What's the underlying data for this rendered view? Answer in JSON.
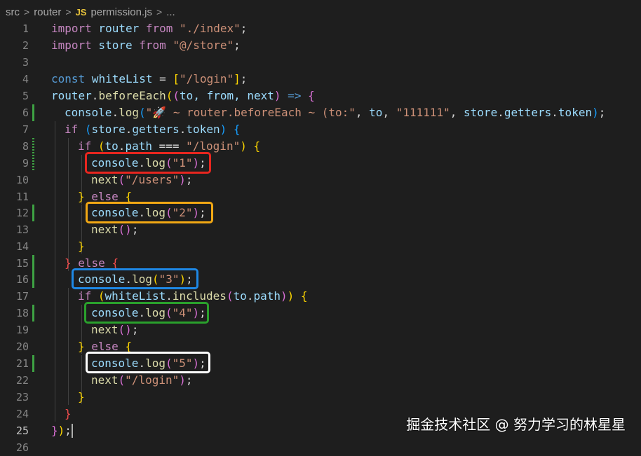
{
  "breadcrumb": {
    "seg1": "src",
    "seg2": "router",
    "file_icon": "JS",
    "file": "permission.js",
    "more": "..."
  },
  "lines": [
    {
      "n": "1"
    },
    {
      "n": "2"
    },
    {
      "n": "3"
    },
    {
      "n": "4"
    },
    {
      "n": "5"
    },
    {
      "n": "6"
    },
    {
      "n": "7"
    },
    {
      "n": "8"
    },
    {
      "n": "9"
    },
    {
      "n": "10"
    },
    {
      "n": "11"
    },
    {
      "n": "12"
    },
    {
      "n": "13"
    },
    {
      "n": "14"
    },
    {
      "n": "15"
    },
    {
      "n": "16"
    },
    {
      "n": "17"
    },
    {
      "n": "18"
    },
    {
      "n": "19"
    },
    {
      "n": "20"
    },
    {
      "n": "21"
    },
    {
      "n": "22"
    },
    {
      "n": "23"
    },
    {
      "n": "24"
    },
    {
      "n": "25"
    },
    {
      "n": "26"
    }
  ],
  "code": {
    "l1": {
      "kw": "import",
      "id": " router ",
      "from": "from",
      "str": " \"./index\"",
      "end": ";"
    },
    "l2": {
      "kw": "import",
      "id": " store ",
      "from": "from",
      "str": " \"@/store\"",
      "end": ";"
    },
    "l4": {
      "kw": "const",
      "id": " whiteList",
      "eq": " = ",
      "ob": "[",
      "str": "\"/login\"",
      "cb": "]",
      "end": ";"
    },
    "l5": {
      "obj": "router",
      "dot": ".",
      "fn": "beforeEach",
      "op1": "(",
      "op2": "(",
      "args": "to, from, next",
      "cp": ")",
      "arrow": " => ",
      "ob": "{"
    },
    "l6": {
      "obj": "console",
      "dot": ".",
      "fn": "log",
      "op": "(",
      "str": "\"🚀 ~ router.beforeEach ~ (to:\"",
      "c1": ", ",
      "v1": "to",
      "c2": ", ",
      "s2": "\"111111\"",
      "c3": ", ",
      "v2": "store",
      "d1": ".",
      "v3": "getters",
      "d2": ".",
      "v4": "token",
      "cp": ")",
      "end": ";"
    },
    "l7": {
      "kw": "if",
      "op": " (",
      "v1": "store",
      "d1": ".",
      "v2": "getters",
      "d2": ".",
      "v3": "token",
      "cp": ")",
      "ob": " {"
    },
    "l8": {
      "kw": "if",
      "op": " (",
      "v1": "to",
      "d1": ".",
      "v2": "path",
      "eq": " === ",
      "str": "\"/login\"",
      "cp": ")",
      "ob": " {"
    },
    "l9": {
      "obj": "console",
      "dot": ".",
      "fn": "log",
      "op": "(",
      "str": "\"1\"",
      "cp": ")",
      "end": ";"
    },
    "l10": {
      "fn": "next",
      "op": "(",
      "str": "\"/users\"",
      "cp": ")",
      "end": ";"
    },
    "l11": {
      "cb": "}",
      "kw": " else ",
      "ob": "{"
    },
    "l12": {
      "obj": "console",
      "dot": ".",
      "fn": "log",
      "op": "(",
      "str": "\"2\"",
      "cp": ")",
      "end": ";"
    },
    "l13": {
      "fn": "next",
      "op": "(",
      "cp": ")",
      "end": ";"
    },
    "l14": {
      "cb": "}"
    },
    "l15": {
      "cb": "}",
      "kw": " else ",
      "ob": "{"
    },
    "l16": {
      "obj": "console",
      "dot": ".",
      "fn": "log",
      "op": "(",
      "str": "\"3\"",
      "cp": ")",
      "end": ";"
    },
    "l17": {
      "kw": "if",
      "op": " (",
      "v1": "whiteList",
      "d1": ".",
      "fn": "includes",
      "op2": "(",
      "v2": "to",
      "d2": ".",
      "v3": "path",
      "cp2": ")",
      "cp": ")",
      "ob": " {"
    },
    "l18": {
      "obj": "console",
      "dot": ".",
      "fn": "log",
      "op": "(",
      "str": "\"4\"",
      "cp": ")",
      "end": ";"
    },
    "l19": {
      "fn": "next",
      "op": "(",
      "cp": ")",
      "end": ";"
    },
    "l20": {
      "cb": "}",
      "kw": " else ",
      "ob": "{"
    },
    "l21": {
      "obj": "console",
      "dot": ".",
      "fn": "log",
      "op": "(",
      "str": "\"5\"",
      "cp": ")",
      "end": ";"
    },
    "l22": {
      "fn": "next",
      "op": "(",
      "str": "\"/login\"",
      "cp": ")",
      "end": ";"
    },
    "l23": {
      "cb": "}"
    },
    "l24": {
      "cb": "}"
    },
    "l25": {
      "cb": "}",
      "cp": ")",
      "end": ";"
    }
  },
  "highlight_colors": {
    "red": "#e8261f",
    "orange": "#f2a814",
    "blue": "#1e88e5",
    "green": "#2aa12c",
    "white": "#ffffff"
  },
  "watermark": "掘金技术社区 @ 努力学习的林星星"
}
